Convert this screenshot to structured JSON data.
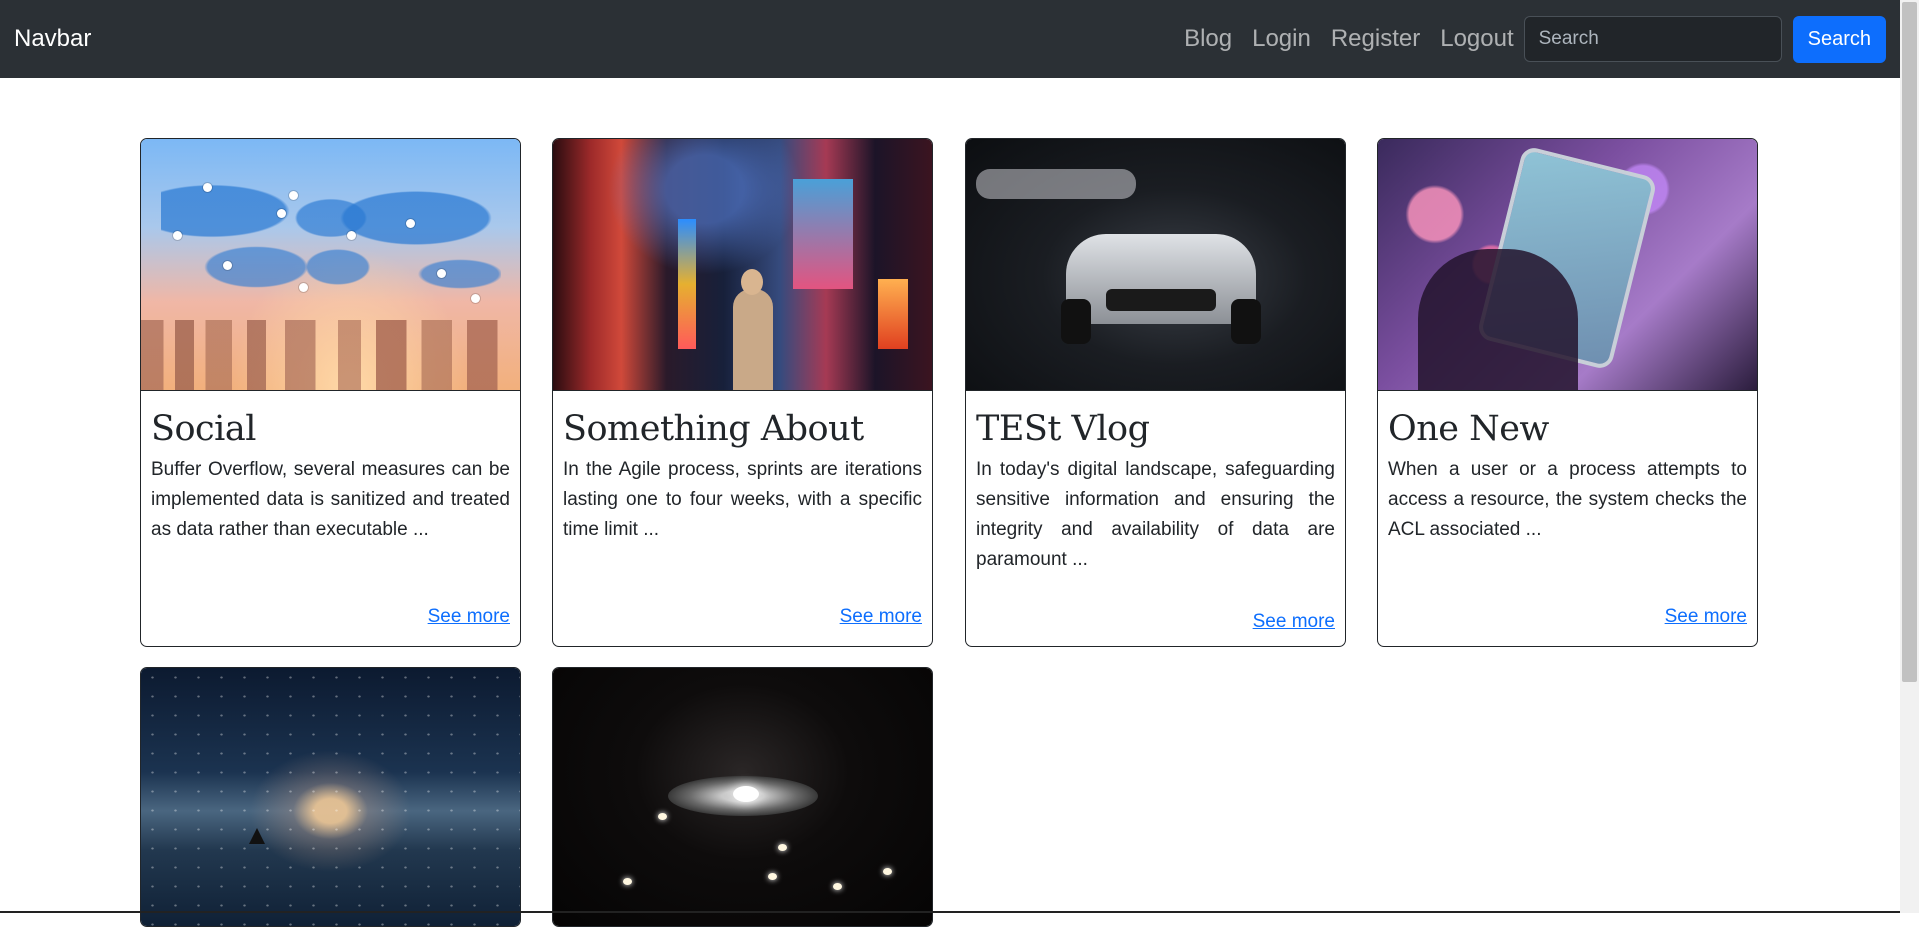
{
  "navbar": {
    "brand": "Navbar",
    "links": [
      "Blog",
      "Login",
      "Register",
      "Logout"
    ],
    "search_placeholder": "Search",
    "search_button": "Search"
  },
  "cards": [
    {
      "title": "Social",
      "text": "Buffer Overflow, several measures can be implemented data is sanitized and treated as data rather than executable ...",
      "link": "See more",
      "image": "world-map-city-image"
    },
    {
      "title": "Something About",
      "text": "In the Agile process, sprints are iterations lasting one to four weeks, with a specific time limit ...",
      "link": "See more",
      "image": "times-square-image"
    },
    {
      "title": "TESt Vlog",
      "text": "In today's digital landscape, safeguarding sensitive information and ensuring the integrity and availability of data are paramount ...",
      "link": "See more",
      "image": "sports-car-image"
    },
    {
      "title": "One New",
      "text": "When a user or a process attempts to access a resource, the system checks the ACL associated ...",
      "link": "See more",
      "image": "phone-bokeh-image"
    },
    {
      "image": "starry-sky-boat-image"
    },
    {
      "image": "ceiling-lamp-image"
    }
  ],
  "colors": {
    "navbar_bg": "#2b3035",
    "primary": "#0d6efd"
  }
}
